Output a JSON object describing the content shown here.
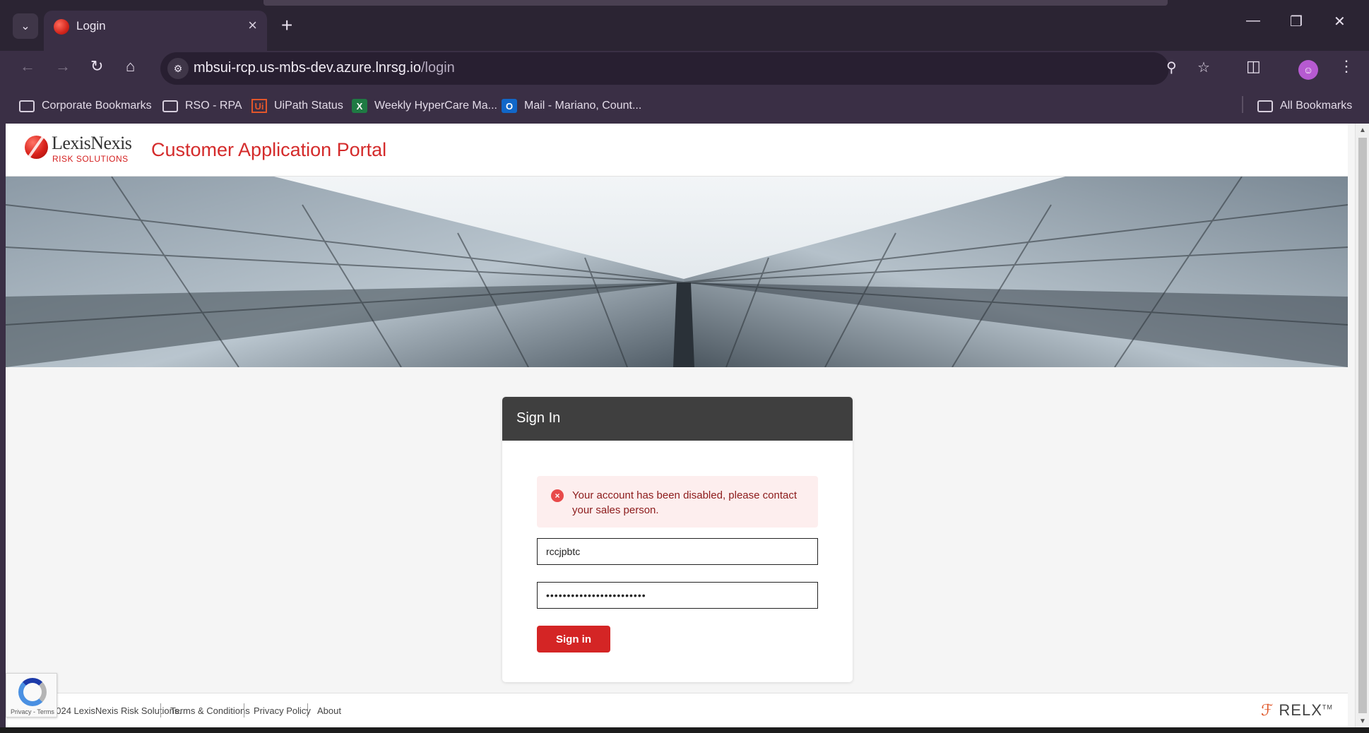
{
  "browser": {
    "tab_title": "Login",
    "new_tab_symbol": "+",
    "url_host": "mbsui-rcp.us-mbs-dev.azure.lnrsg.io",
    "url_path": "/login",
    "bookmarks": [
      {
        "label": "Corporate Bookmarks",
        "icon": "folder-settings-icon"
      },
      {
        "label": "RSO - RPA",
        "icon": "folder-icon"
      },
      {
        "label": "UiPath Status",
        "icon": "uipath-icon"
      },
      {
        "label": "Weekly HyperCare Ma...",
        "icon": "excel-icon"
      },
      {
        "label": "Mail - Mariano, Count...",
        "icon": "outlook-icon"
      }
    ],
    "all_bookmarks": "All Bookmarks"
  },
  "header": {
    "brand_name": "LexisNexis",
    "brand_sub": "RISK SOLUTIONS",
    "portal_title": "Customer Application Portal"
  },
  "signin": {
    "title": "Sign In",
    "error_message": "Your account has been disabled, please contact your sales person.",
    "username_value": "rccjpbtc",
    "password_value": "••••••••••••••••••••••••",
    "button_label": "Sign in"
  },
  "footer": {
    "copyright": "2024 LexisNexis Risk Solutions.",
    "links": [
      "Terms & Conditions",
      "Privacy Policy",
      "About"
    ],
    "relx": "RELX"
  },
  "recaptcha": {
    "links": "Privacy - Terms"
  },
  "colors": {
    "brand_red": "#d42b2b",
    "chrome_dark": "#2b2433",
    "alert_bg": "#fdeeee"
  }
}
